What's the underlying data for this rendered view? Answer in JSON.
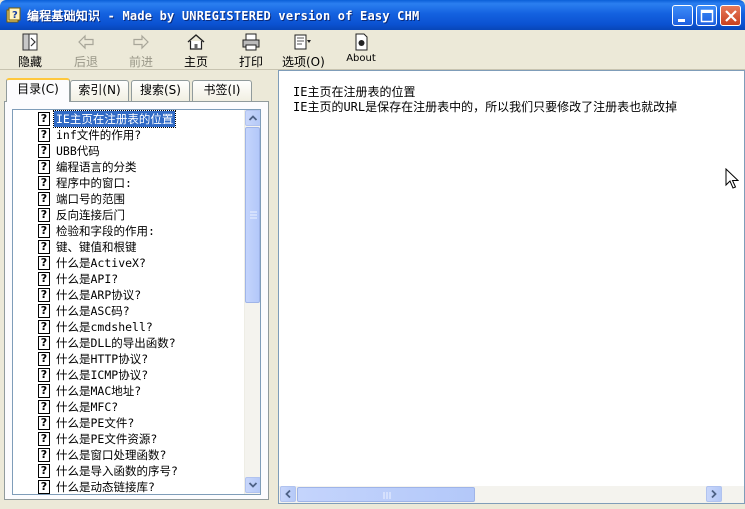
{
  "window": {
    "title": "编程基础知识 - Made by UNREGISTERED version of Easy CHM",
    "icon": "help-book-icon"
  },
  "toolbar": {
    "hide": "隐藏",
    "back": "后退",
    "forward": "前进",
    "home": "主页",
    "print": "打印",
    "options": "选项(O)",
    "about": "About"
  },
  "tabs": {
    "contents": "目录(C)",
    "index": "索引(N)",
    "search": "搜索(S)",
    "bookmarks": "书签(I)"
  },
  "tree": {
    "items": [
      "IE主页在注册表的位置",
      "inf文件的作用?",
      "UBB代码",
      "编程语言的分类",
      "程序中的窗口:",
      "端口号的范围",
      "反向连接后门",
      "检验和字段的作用:",
      "键、键值和根键",
      "什么是ActiveX?",
      "什么是API?",
      "什么是ARP协议?",
      "什么是ASC码?",
      "什么是cmdshell?",
      "什么是DLL的导出函数?",
      "什么是HTTP协议?",
      "什么是ICMP协议?",
      "什么是MAC地址?",
      "什么是MFC?",
      "什么是PE文件?",
      "什么是PE文件资源?",
      "什么是窗口处理函数?",
      "什么是导入函数的序号?",
      "什么是动态链接库?"
    ],
    "selected_index": 0
  },
  "content": {
    "heading": "IE主页在注册表的位置",
    "body": "IE主页的URL是保存在注册表中的，所以我们只要修改了注册表也就改掉"
  },
  "colors": {
    "titlebar": "#0b52d2",
    "selection": "#316ac5",
    "face": "#ece9d8"
  }
}
